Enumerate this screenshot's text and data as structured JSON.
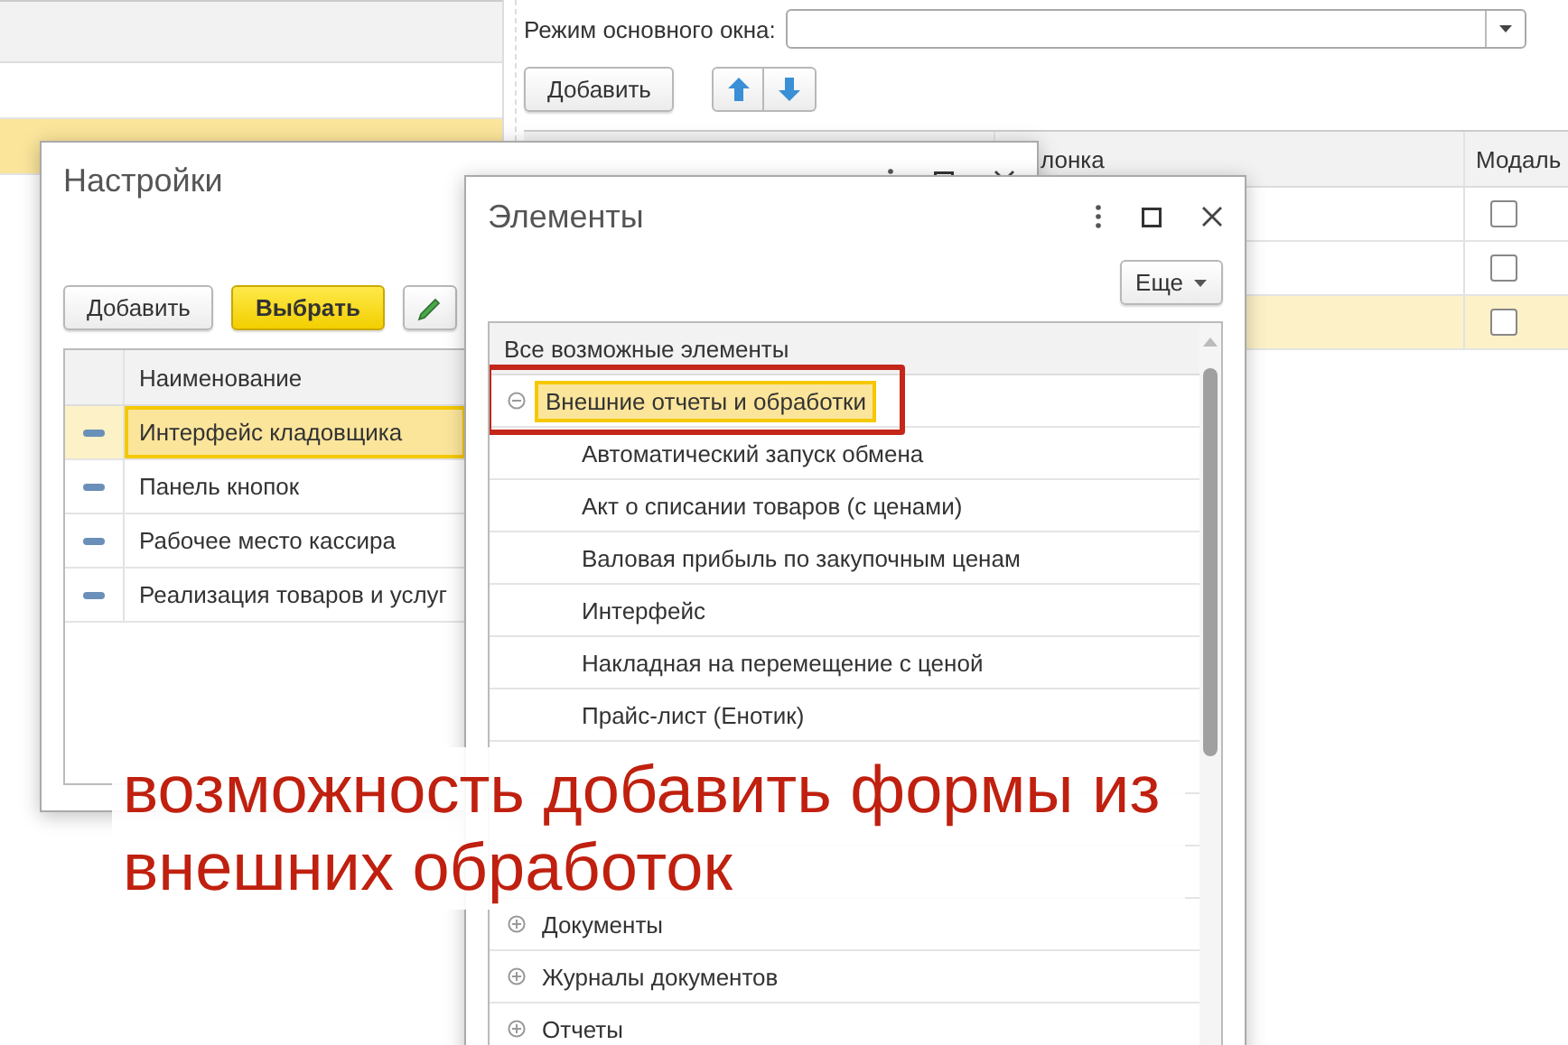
{
  "main_window": {
    "mode_field": {
      "label": "Режим основного окна:"
    },
    "add_button": "Добавить",
    "table": {
      "columns": [
        "лонка",
        "Модаль"
      ],
      "rows": [
        {
          "selected": false,
          "checked": false
        },
        {
          "selected": false,
          "checked": false
        },
        {
          "selected": true,
          "checked": false
        }
      ]
    },
    "left_list": {
      "rows": [
        {
          "selected": false
        },
        {
          "selected": true
        }
      ]
    }
  },
  "settings_window": {
    "title": "Настройки",
    "buttons": [
      {
        "label": "Добавить",
        "kind": "default"
      },
      {
        "label": "Выбрать",
        "kind": "primary"
      }
    ],
    "column": "Наименование",
    "rows": [
      {
        "name": "Интерфейс кладовщика",
        "selected": true
      },
      {
        "name": "Панель кнопок",
        "selected": false
      },
      {
        "name": "Рабочее место кассира",
        "selected": false
      },
      {
        "name": "Реализация товаров и услуг",
        "selected": false
      }
    ]
  },
  "elements_window": {
    "title": "Элементы",
    "more_button": "Еще",
    "tree": {
      "header": "Все возможные элементы",
      "items": [
        {
          "label": "Внешние отчеты и обработки",
          "expanded": true,
          "selected": true,
          "highlighted": true,
          "children": [
            {
              "label": "Автоматический запуск обмена"
            },
            {
              "label": "Акт о списании товаров (с ценами)"
            },
            {
              "label": "Валовая прибыль по закупочным ценам"
            },
            {
              "label": "Интерфейс"
            },
            {
              "label": "Накладная на перемещение с ценой"
            },
            {
              "label": "Прайс-лист (Енотик)"
            }
          ]
        },
        {
          "label": "Документы",
          "expanded": false,
          "selected": false,
          "highlighted": false
        },
        {
          "label": "Журналы документов",
          "expanded": false,
          "selected": false,
          "highlighted": false
        },
        {
          "label": "Отчеты",
          "expanded": false,
          "selected": false,
          "highlighted": false
        }
      ]
    }
  },
  "caption": "возможность добавить формы из внешних обработок"
}
